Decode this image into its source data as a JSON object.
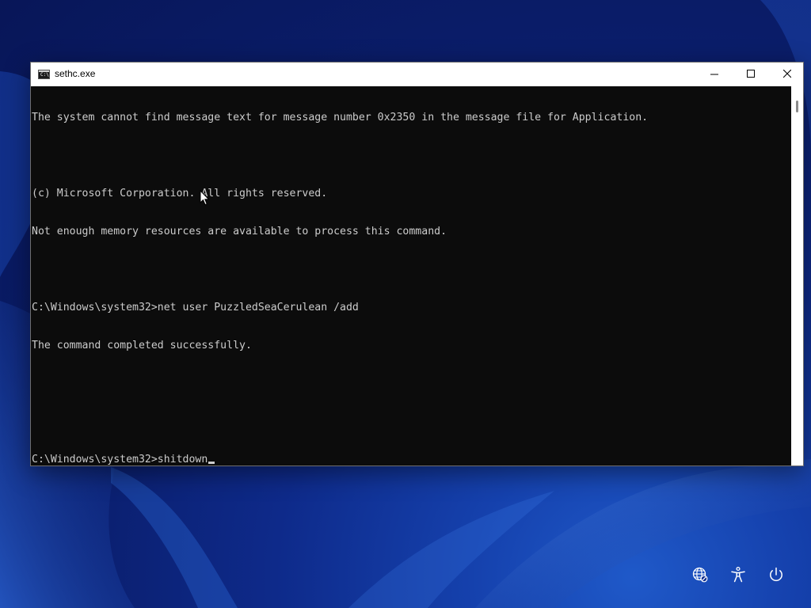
{
  "window": {
    "title": "sethc.exe",
    "icon": "console-icon",
    "icon_text": "C:\\",
    "caption_buttons": {
      "minimize": "minimize-icon",
      "maximize": "maximize-icon",
      "close": "close-icon"
    }
  },
  "console": {
    "lines": [
      "The system cannot find message text for message number 0x2350 in the message file for Application.",
      "",
      "(c) Microsoft Corporation. All rights reserved.",
      "Not enough memory resources are available to process this command.",
      "",
      "C:\\Windows\\system32>net user PuzzledSeaCerulean /add",
      "The command completed successfully.",
      "",
      "",
      "C:\\Windows\\system32>shitdown"
    ],
    "text_color": "#cccccc",
    "background_color": "#0c0c0c"
  },
  "lockscreen": {
    "icons": [
      "network-icon",
      "accessibility-icon",
      "power-icon"
    ]
  },
  "colors": {
    "wallpaper": "#0e2a8a",
    "titlebar": "#ffffff"
  }
}
